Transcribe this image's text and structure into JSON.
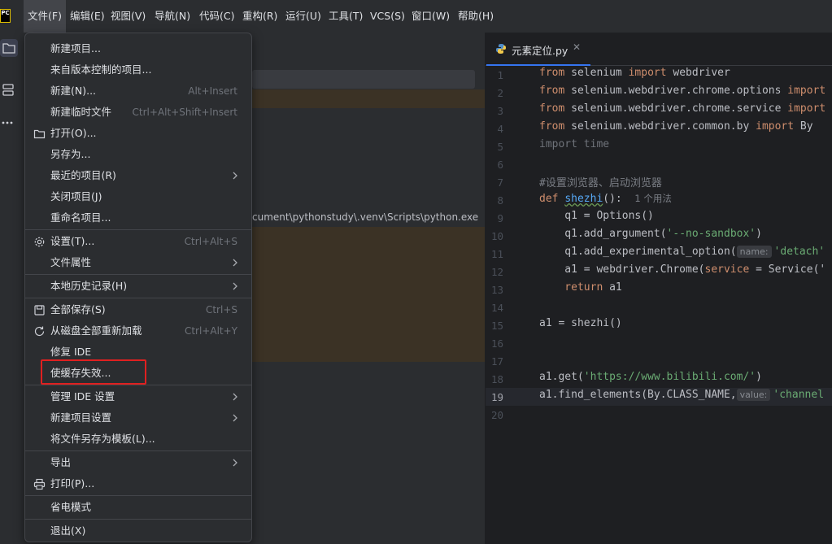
{
  "app": {
    "logo_text": "PC"
  },
  "menubar": {
    "items": [
      "文件(F)",
      "编辑(E)",
      "视图(V)",
      "导航(N)",
      "代码(C)",
      "重构(R)",
      "运行(U)",
      "工具(T)",
      "VCS(S)",
      "窗口(W)",
      "帮助(H)"
    ]
  },
  "file_menu": {
    "items": [
      {
        "label": "新建项目...",
        "shortcut": ""
      },
      {
        "label": "来自版本控制的项目...",
        "shortcut": ""
      },
      {
        "label": "新建(N)...",
        "shortcut": "Alt+Insert"
      },
      {
        "label": "新建临时文件",
        "shortcut": "Ctrl+Alt+Shift+Insert"
      },
      {
        "label": "打开(O)...",
        "shortcut": "",
        "icon": "folder-icon"
      },
      {
        "label": "另存为...",
        "shortcut": ""
      },
      {
        "label": "最近的项目(R)",
        "shortcut": "",
        "submenu": true
      },
      {
        "label": "关闭项目(J)",
        "shortcut": ""
      },
      {
        "label": "重命名项目...",
        "shortcut": ""
      },
      {
        "label": "设置(T)...",
        "shortcut": "Ctrl+Alt+S",
        "icon": "gear-icon"
      },
      {
        "label": "文件属性",
        "shortcut": "",
        "submenu": true
      },
      {
        "label": "本地历史记录(H)",
        "shortcut": "",
        "submenu": true
      },
      {
        "label": "全部保存(S)",
        "shortcut": "Ctrl+S",
        "icon": "save-icon"
      },
      {
        "label": "从磁盘全部重新加载",
        "shortcut": "Ctrl+Alt+Y",
        "icon": "reload-icon"
      },
      {
        "label": "修复 IDE",
        "shortcut": ""
      },
      {
        "label": "使缓存失效...",
        "shortcut": ""
      },
      {
        "label": "管理 IDE 设置",
        "shortcut": "",
        "submenu": true
      },
      {
        "label": "新建项目设置",
        "shortcut": "",
        "submenu": true
      },
      {
        "label": "将文件另存为模板(L)...",
        "shortcut": ""
      },
      {
        "label": "导出",
        "shortcut": "",
        "submenu": true
      },
      {
        "label": "打印(P)...",
        "shortcut": "",
        "icon": "print-icon"
      },
      {
        "label": "省电模式",
        "shortcut": ""
      },
      {
        "label": "退出(X)",
        "shortcut": ""
      }
    ]
  },
  "left_panel": {
    "path_text": "cument\\pythonstudy\\.venv\\Scripts\\python.exe"
  },
  "editor": {
    "tab_label": "元素定位.py",
    "line_numbers": [
      "1",
      "2",
      "3",
      "4",
      "5",
      "6",
      "7",
      "8",
      "9",
      "10",
      "11",
      "12",
      "13",
      "14",
      "15",
      "16",
      "17",
      "18",
      "19",
      "20"
    ],
    "current_line": "19",
    "code": {
      "l1_a": "from",
      "l1_b": " selenium ",
      "l1_c": "import",
      "l1_d": " webdriver",
      "l2_a": "from",
      "l2_b": " selenium.webdriver.chrome.options ",
      "l2_c": "import",
      "l3_a": "from",
      "l3_b": " selenium.webdriver.chrome.service ",
      "l3_c": "import",
      "l4_a": "from",
      "l4_b": " selenium.webdriver.common.by ",
      "l4_c": "import",
      "l4_d": " By",
      "l5": "import time",
      "l7": "#设置浏览器、启动浏览器",
      "l8_a": "def",
      "l8_b": "shezhi",
      "l8_c": "():",
      "l8_usages": "1 个用法",
      "l9": "    q1 = Options()",
      "l10_a": "    q1.add_argument(",
      "l10_b": "'--no-sandbox'",
      "l10_c": ")",
      "l11_a": "    q1.add_experimental_option(",
      "l11_hint": "name:",
      "l11_b": "'detach'",
      "l12_a": "    a1 = webdriver.Chrome(",
      "l12_b": "service",
      "l12_c": " = Service('",
      "l13_a": "    return",
      "l13_b": " a1",
      "l15": "a1 = shezhi()",
      "l18_a": "a1.get(",
      "l18_b": "'https://www.bilibili.com/'",
      "l18_c": ")",
      "l19_a": "a1.find_elements(By.CLASS_NAME,",
      "l19_hint": "value:",
      "l19_b": "'channel"
    }
  },
  "colors": {
    "keyword": "#cf8e6d",
    "string": "#6aab73",
    "comment": "#7a7e85",
    "function": "#56a8f5",
    "highlight_box": "#e02020"
  }
}
